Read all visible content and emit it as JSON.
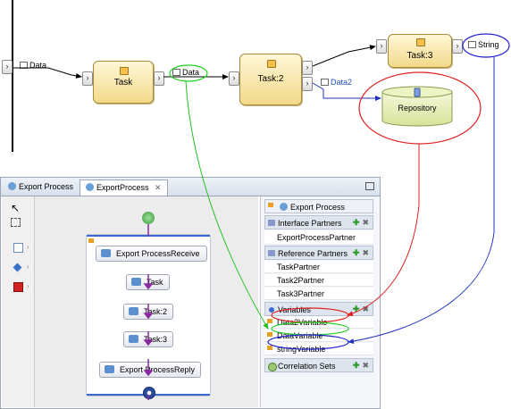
{
  "diagram": {
    "tasks": [
      {
        "label": "Task"
      },
      {
        "label": "Task:2"
      },
      {
        "label": "Task:3"
      }
    ],
    "data_labels": [
      "Data",
      "Data",
      "Data2",
      "String"
    ],
    "repository": {
      "label": "Repository"
    }
  },
  "editor": {
    "tabs": [
      {
        "label": "Export Process"
      },
      {
        "label": "ExportProcess"
      }
    ],
    "activities": [
      {
        "label": "Export ProcessReceive"
      },
      {
        "label": "Task"
      },
      {
        "label": "Task:2"
      },
      {
        "label": "Task:3"
      },
      {
        "label": "Export ProcessReply"
      }
    ],
    "side": {
      "title": "Export Process",
      "interface_partners": {
        "label": "Interface Partners",
        "items": [
          "ExportProcessPartner"
        ]
      },
      "reference_partners": {
        "label": "Reference Partners",
        "items": [
          "TaskPartner",
          "Task2Partner",
          "Task3Partner"
        ]
      },
      "variables": {
        "label": "Variables",
        "items": [
          "Data2Variable",
          "DataVariable",
          "stringVariable"
        ]
      },
      "correlation_sets": {
        "label": "Correlation Sets"
      }
    }
  },
  "colors": {
    "red": "#e02020",
    "green": "#2ad42a",
    "blue": "#2020d0"
  }
}
